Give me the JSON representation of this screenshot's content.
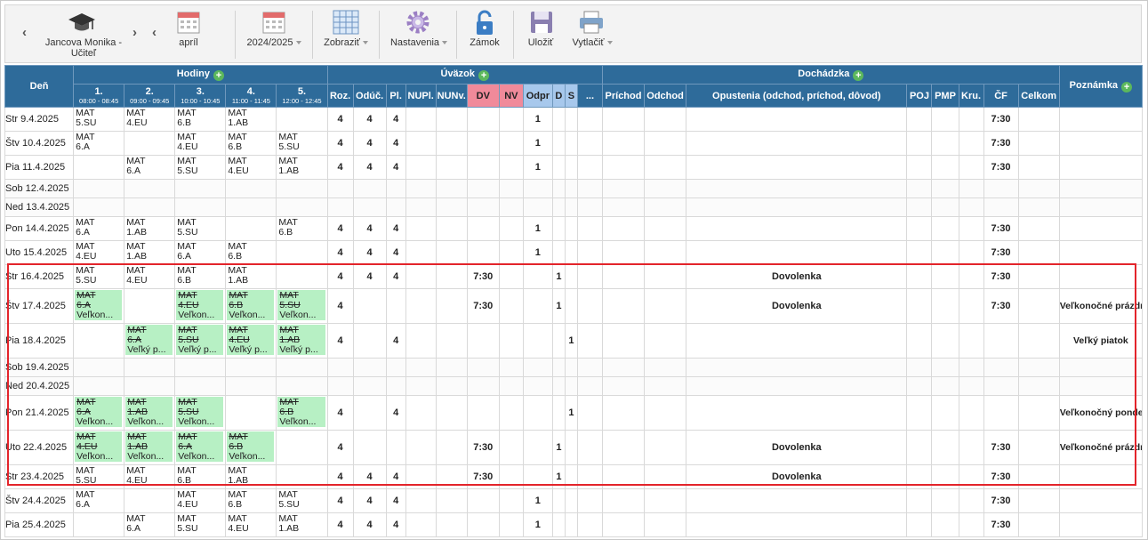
{
  "toolbar": {
    "user": {
      "line1": "Jancova Monika -",
      "line2": "Učiteľ"
    },
    "month": "apríl",
    "year": "2024/2025",
    "show": "Zobraziť",
    "settings": "Nastavenia",
    "lock": "Zámok",
    "save": "Uložiť",
    "print": "Vytlačiť"
  },
  "header": {
    "day": "Deň",
    "hodiny": "Hodiny",
    "uvazok": "Úväzok",
    "dochadzka": "Dochádzka",
    "poznamka": "Poznámka",
    "periods": [
      {
        "n": "1.",
        "t": "08:00 - 08:45"
      },
      {
        "n": "2.",
        "t": "09:00 - 09:45"
      },
      {
        "n": "3.",
        "t": "10:00 - 10:45"
      },
      {
        "n": "4.",
        "t": "11:00 - 11:45"
      },
      {
        "n": "5.",
        "t": "12:00 - 12:45"
      }
    ],
    "uv_cols": [
      "Roz.",
      "Odúč.",
      "Pl.",
      "NUPl.",
      "NUNv.",
      "DV",
      "NV",
      "Odpr",
      "D",
      "S",
      "..."
    ],
    "doch_cols": [
      "Príchod",
      "Odchod",
      "Opustenia (odchod, príchod, dôvod)",
      "POJ",
      "PMP",
      "Kru.",
      "ČF",
      "Celkom"
    ]
  },
  "rows": [
    {
      "day": "Str 9.4.2025",
      "h": "n",
      "les": [
        [
          "MAT",
          "5.SU"
        ],
        [
          "MAT",
          "4.EU"
        ],
        [
          "MAT",
          "6.B"
        ],
        [
          "MAT",
          "1.AB"
        ],
        null
      ],
      "roz": "4",
      "oduc": "4",
      "pl": "4",
      "dv": "",
      "odpr": "1",
      "d": "",
      "s": "",
      "abs": "",
      "cf": "7:30",
      "note": ""
    },
    {
      "day": "Štv 10.4.2025",
      "h": "n",
      "les": [
        [
          "MAT",
          "6.A"
        ],
        null,
        [
          "MAT",
          "4.EU"
        ],
        [
          "MAT",
          "6.B"
        ],
        [
          "MAT",
          "5.SU"
        ]
      ],
      "roz": "4",
      "oduc": "4",
      "pl": "4",
      "dv": "",
      "odpr": "1",
      "d": "",
      "s": "",
      "abs": "",
      "cf": "7:30",
      "note": ""
    },
    {
      "day": "Pia 11.4.2025",
      "h": "n",
      "les": [
        null,
        [
          "MAT",
          "6.A"
        ],
        [
          "MAT",
          "5.SU"
        ],
        [
          "MAT",
          "4.EU"
        ],
        [
          "MAT",
          "1.AB"
        ]
      ],
      "roz": "4",
      "oduc": "4",
      "pl": "4",
      "dv": "",
      "odpr": "1",
      "d": "",
      "s": "",
      "abs": "",
      "cf": "7:30",
      "note": ""
    },
    {
      "day": "Sob 12.4.2025",
      "h": "s",
      "we": true
    },
    {
      "day": "Ned 13.4.2025",
      "h": "s",
      "we": true
    },
    {
      "day": "Pon 14.4.2025",
      "h": "n",
      "les": [
        [
          "MAT",
          "6.A"
        ],
        [
          "MAT",
          "1.AB"
        ],
        [
          "MAT",
          "5.SU"
        ],
        null,
        [
          "MAT",
          "6.B"
        ]
      ],
      "roz": "4",
      "oduc": "4",
      "pl": "4",
      "dv": "",
      "odpr": "1",
      "d": "",
      "s": "",
      "abs": "",
      "cf": "7:30",
      "note": ""
    },
    {
      "day": "Uto 15.4.2025",
      "h": "n",
      "les": [
        [
          "MAT",
          "4.EU"
        ],
        [
          "MAT",
          "1.AB"
        ],
        [
          "MAT",
          "6.A"
        ],
        [
          "MAT",
          "6.B"
        ],
        null
      ],
      "roz": "4",
      "oduc": "4",
      "pl": "4",
      "dv": "",
      "odpr": "1",
      "d": "",
      "s": "",
      "abs": "",
      "cf": "7:30",
      "note": ""
    },
    {
      "day": "Str 16.4.2025",
      "h": "n",
      "les": [
        [
          "MAT",
          "5.SU"
        ],
        [
          "MAT",
          "4.EU"
        ],
        [
          "MAT",
          "6.B"
        ],
        [
          "MAT",
          "1.AB"
        ],
        null
      ],
      "roz": "4",
      "oduc": "4",
      "pl": "4",
      "dv": "7:30",
      "odpr": "",
      "d": "1",
      "s": "",
      "abs": "Dovolenka",
      "cf": "7:30",
      "note": ""
    },
    {
      "day": "Štv 17.4.2025",
      "h": "t",
      "les": [
        [
          "MAT",
          "6.A",
          "Veľkon...",
          "g"
        ],
        null,
        [
          "MAT",
          "4.EU",
          "Veľkon...",
          "g"
        ],
        [
          "MAT",
          "6.B",
          "Veľkon...",
          "g"
        ],
        [
          "MAT",
          "5.SU",
          "Veľkon...",
          "g"
        ]
      ],
      "roz": "4",
      "oduc": "",
      "pl": "",
      "dv": "7:30",
      "odpr": "",
      "d": "1",
      "s": "",
      "abs": "Dovolenka",
      "cf": "7:30",
      "note": "Veľkonočné prázdniny"
    },
    {
      "day": "Pia 18.4.2025",
      "h": "t",
      "les": [
        null,
        [
          "MAT",
          "6.A",
          "Veľký p...",
          "g"
        ],
        [
          "MAT",
          "5.SU",
          "Veľký p...",
          "g"
        ],
        [
          "MAT",
          "4.EU",
          "Veľký p...",
          "g"
        ],
        [
          "MAT",
          "1.AB",
          "Veľký p...",
          "g"
        ]
      ],
      "roz": "4",
      "oduc": "",
      "pl": "4",
      "dv": "",
      "odpr": "",
      "d": "",
      "s": "1",
      "abs": "",
      "cf": "",
      "note": "Veľký piatok"
    },
    {
      "day": "Sob 19.4.2025",
      "h": "s",
      "we": true
    },
    {
      "day": "Ned 20.4.2025",
      "h": "s",
      "we": true
    },
    {
      "day": "Pon 21.4.2025",
      "h": "t",
      "les": [
        [
          "MAT",
          "6.A",
          "Veľkon...",
          "g"
        ],
        [
          "MAT",
          "1.AB",
          "Veľkon...",
          "g"
        ],
        [
          "MAT",
          "5.SU",
          "Veľkon...",
          "g"
        ],
        null,
        [
          "MAT",
          "6.B",
          "Veľkon...",
          "g"
        ]
      ],
      "roz": "4",
      "oduc": "",
      "pl": "4",
      "dv": "",
      "odpr": "",
      "d": "",
      "s": "1",
      "abs": "",
      "cf": "",
      "note": "Veľkonočný pondelok"
    },
    {
      "day": "Uto 22.4.2025",
      "h": "t",
      "les": [
        [
          "MAT",
          "4.EU",
          "Veľkon...",
          "g"
        ],
        [
          "MAT",
          "1.AB",
          "Veľkon...",
          "g"
        ],
        [
          "MAT",
          "6.A",
          "Veľkon...",
          "g"
        ],
        [
          "MAT",
          "6.B",
          "Veľkon...",
          "g"
        ],
        null
      ],
      "roz": "4",
      "oduc": "",
      "pl": "",
      "dv": "7:30",
      "odpr": "",
      "d": "1",
      "s": "",
      "abs": "Dovolenka",
      "cf": "7:30",
      "note": "Veľkonočné prázdniny"
    },
    {
      "day": "Str 23.4.2025",
      "h": "n",
      "les": [
        [
          "MAT",
          "5.SU"
        ],
        [
          "MAT",
          "4.EU"
        ],
        [
          "MAT",
          "6.B"
        ],
        [
          "MAT",
          "1.AB"
        ],
        null
      ],
      "roz": "4",
      "oduc": "4",
      "pl": "4",
      "dv": "7:30",
      "odpr": "",
      "d": "1",
      "s": "",
      "abs": "Dovolenka",
      "cf": "7:30",
      "note": ""
    },
    {
      "day": "Štv 24.4.2025",
      "h": "n",
      "les": [
        [
          "MAT",
          "6.A"
        ],
        null,
        [
          "MAT",
          "4.EU"
        ],
        [
          "MAT",
          "6.B"
        ],
        [
          "MAT",
          "5.SU"
        ]
      ],
      "roz": "4",
      "oduc": "4",
      "pl": "4",
      "dv": "",
      "odpr": "1",
      "d": "",
      "s": "",
      "abs": "",
      "cf": "7:30",
      "note": ""
    },
    {
      "day": "Pia 25.4.2025",
      "h": "n",
      "les": [
        null,
        [
          "MAT",
          "6.A"
        ],
        [
          "MAT",
          "5.SU"
        ],
        [
          "MAT",
          "4.EU"
        ],
        [
          "MAT",
          "1.AB"
        ]
      ],
      "roz": "4",
      "oduc": "4",
      "pl": "4",
      "dv": "",
      "odpr": "1",
      "d": "",
      "s": "",
      "abs": "",
      "cf": "7:30",
      "note": ""
    }
  ]
}
